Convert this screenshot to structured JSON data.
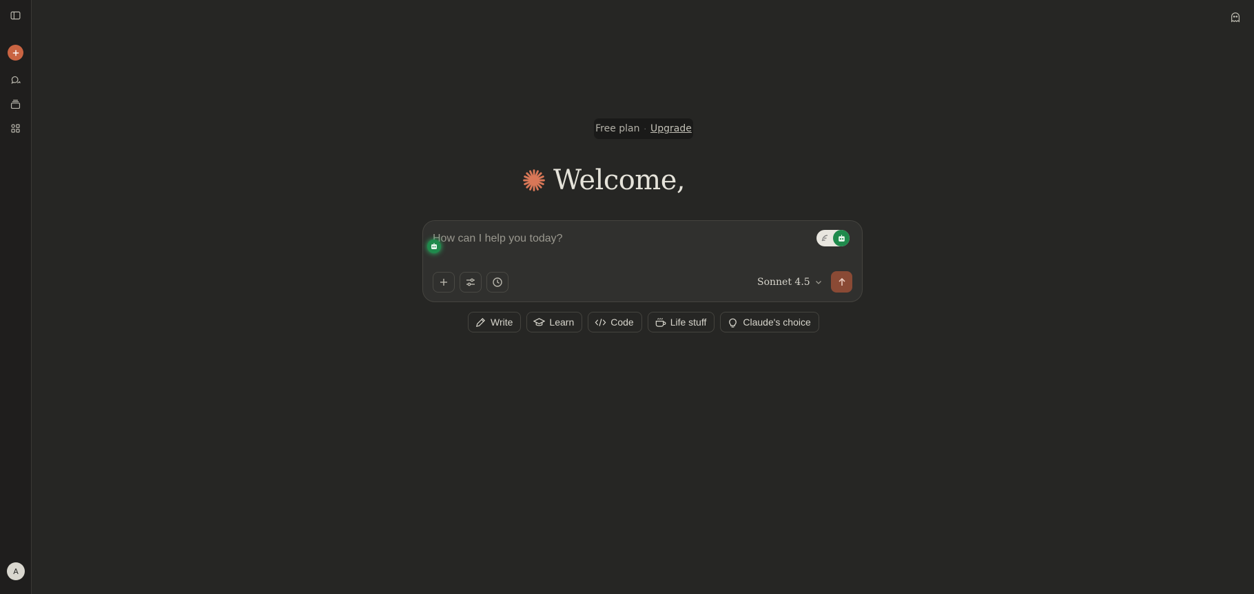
{
  "sidebar": {
    "toggle_icon": "sidebar-toggle-icon",
    "new_chat_icon": "plus-icon",
    "chats_icon": "chat-bubbles-icon",
    "projects_icon": "projects-icon",
    "artifacts_icon": "apps-grid-icon",
    "avatar_initial": "A"
  },
  "topbar": {
    "incognito_icon": "ghost-icon"
  },
  "plan": {
    "label": "Free plan",
    "separator": "·",
    "upgrade": "Upgrade"
  },
  "welcome": {
    "text": "Welcome,"
  },
  "composer": {
    "placeholder": "How can I help you today?",
    "model": "Sonnet 4.5",
    "tools": [
      "plus-icon",
      "sliders-icon",
      "clock-icon"
    ],
    "send_icon": "arrow-up-icon"
  },
  "chips": [
    {
      "label": "Write",
      "icon": "pencil-icon"
    },
    {
      "label": "Learn",
      "icon": "graduation-cap-icon"
    },
    {
      "label": "Code",
      "icon": "code-icon"
    },
    {
      "label": "Life stuff",
      "icon": "coffee-cup-icon"
    },
    {
      "label": "Claude's choice",
      "icon": "lightbulb-icon"
    }
  ],
  "colors": {
    "background": "#262624",
    "sidebar": "#1f1e1d",
    "accent": "#c96442",
    "send": "#8a4a35",
    "extension_green": "#1f8a4c"
  }
}
